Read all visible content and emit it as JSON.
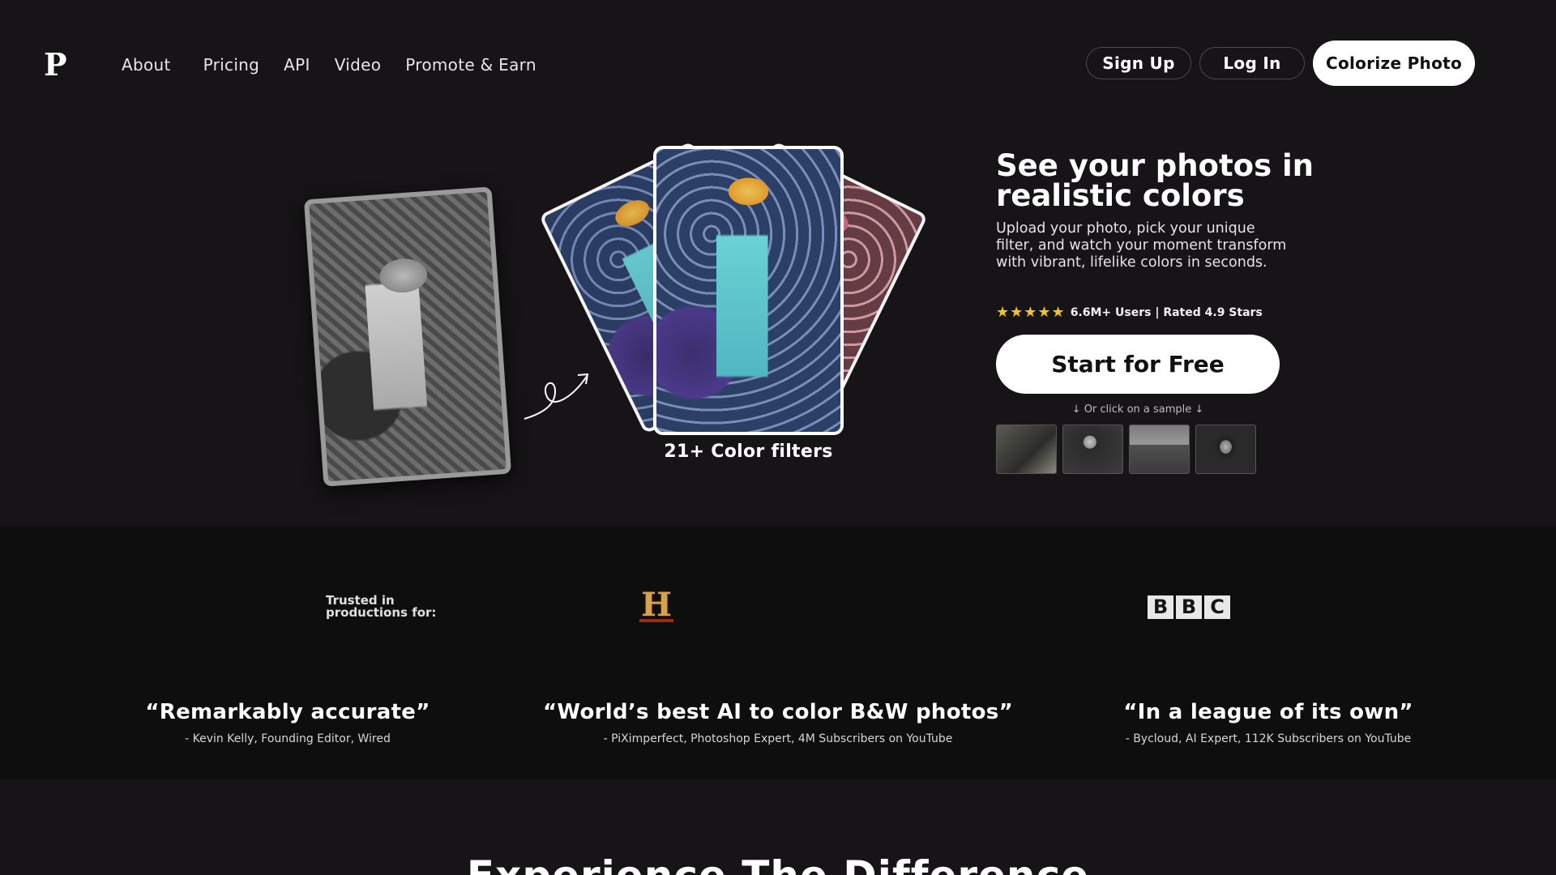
{
  "header": {
    "logo": "P",
    "nav": [
      "About",
      "Pricing",
      "API",
      "Video",
      "Promote & Earn"
    ],
    "signup_label": "Sign Up",
    "login_label": "Log In",
    "colorize_label": "Colorize Photo"
  },
  "hero": {
    "title": "See your photos in realistic colors",
    "subtitle": "Upload your photo, pick your unique filter, and watch your moment transform with vibrant, lifelike colors in seconds.",
    "stars": "★★★★★",
    "rating_text": "6.6M+ Users | Rated 4.9 Stars",
    "cta_label": "Start for Free",
    "sample_hint": "↓ Or click on a sample ↓",
    "filters_label": "21+ Color filters"
  },
  "trusted": {
    "label": "Trusted in productions for:",
    "history_logo": "H",
    "bbc_letters": [
      "B",
      "B",
      "C"
    ]
  },
  "quotes": [
    {
      "text": "“Remarkably accurate”",
      "author": "- Kevin Kelly, Founding Editor, Wired"
    },
    {
      "text": "“World’s best AI to color B&W photos”",
      "author": "- PiXimperfect, Photoshop Expert, 4M Subscribers on YouTube"
    },
    {
      "text": "“In a league of its own”",
      "author": "- Bycloud, AI Expert, 112K Subscribers on YouTube"
    }
  ],
  "section_title": "Experience The Difference",
  "colors": {
    "background": "#161416",
    "band": "#0f0e0f",
    "star": "#f5c518"
  }
}
